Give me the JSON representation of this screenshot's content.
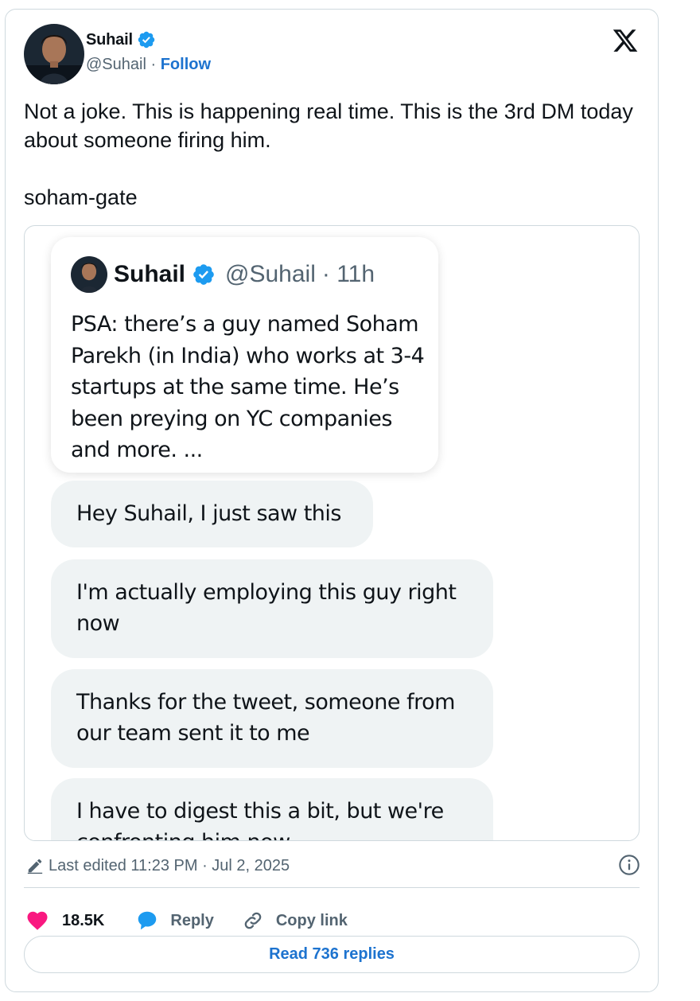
{
  "author": {
    "name": "Suhail",
    "handle": "@Suhail",
    "separator": "·",
    "follow_label": "Follow"
  },
  "tweet": {
    "text": "Not a joke. This is happening real time. This is the 3rd DM today about someone firing him.",
    "tag": "soham-gate"
  },
  "media": {
    "quoted_tweet": {
      "name": "Suhail",
      "handle": "@Suhail",
      "time": "· 11h",
      "text": "PSA: there’s a guy named Soham Parekh (in India) who works at 3-4 startups at the same time. He’s been preying on YC companies and more. ..."
    },
    "messages": [
      "Hey Suhail, I just saw this",
      "I'm actually employing this guy right now",
      "Thanks for the tweet, someone from our team sent it to me",
      "I have to digest this a bit, but we're confronting him now"
    ]
  },
  "meta": {
    "edited_label": "Last edited 11:23 PM · Jul 2, 2025"
  },
  "actions": {
    "likes": "18.5K",
    "reply_label": "Reply",
    "copy_label": "Copy link"
  },
  "read_replies_label": "Read 736 replies",
  "colors": {
    "accent": "#1d73cf",
    "verified": "#1d9bf0",
    "like": "#f91880",
    "bubble": "#eff3f4",
    "muted": "#536471",
    "border": "#cfd9de"
  }
}
